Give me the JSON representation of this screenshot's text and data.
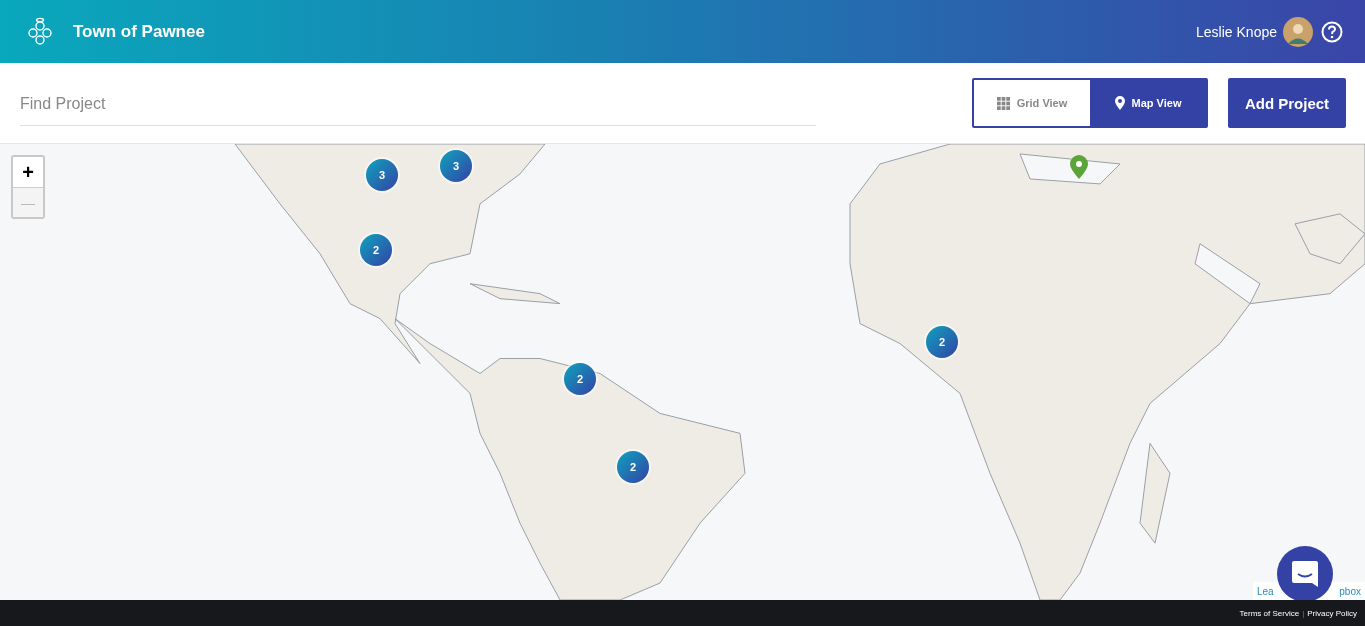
{
  "header": {
    "title": "Town of Pawnee",
    "user_name": "Leslie Knope"
  },
  "toolbar": {
    "search": {
      "placeholder": "Find Project"
    },
    "view_tabs": [
      {
        "label": "Grid View",
        "kind": "grid",
        "selected": false
      },
      {
        "label": "Map View",
        "kind": "map",
        "selected": true
      }
    ],
    "add_button": "Add Project"
  },
  "map": {
    "kind": "picture",
    "zoom_controls": [
      {
        "label": "+",
        "disabled": false
      },
      {
        "label": "—",
        "disabled": true
      }
    ],
    "markers": [
      {
        "kind": "cluster",
        "count": "3"
      },
      {
        "kind": "cluster",
        "count": "3"
      },
      {
        "kind": "cluster",
        "count": "2"
      },
      {
        "kind": "cluster",
        "count": "2"
      },
      {
        "kind": "cluster",
        "count": "2"
      },
      {
        "kind": "cluster",
        "count": "2"
      },
      {
        "kind": "pin"
      }
    ],
    "attribution": [
      "Lea",
      "pbox"
    ]
  },
  "footer": {
    "links": [
      "Terms of Service",
      "Privacy Policy"
    ],
    "separator": "|"
  }
}
